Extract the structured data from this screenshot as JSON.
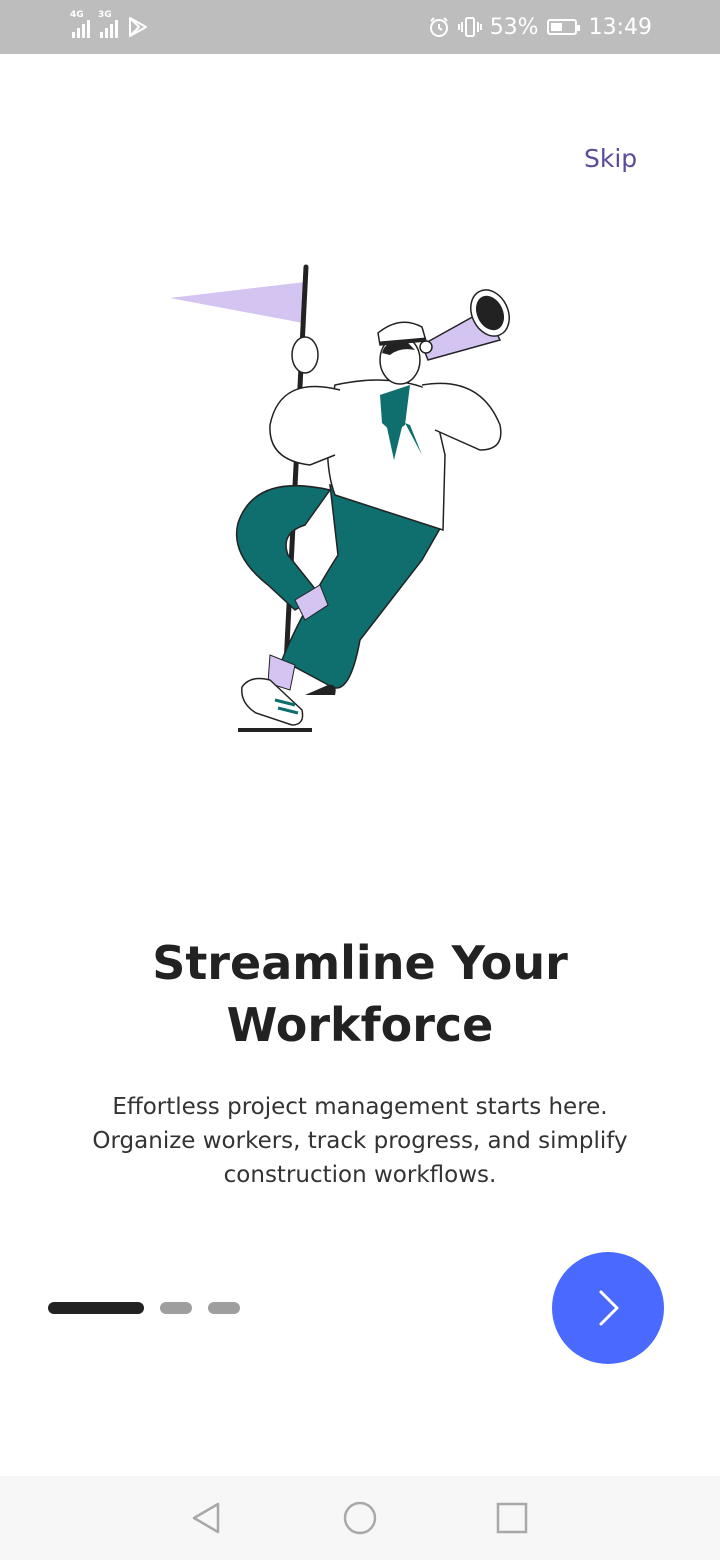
{
  "status_bar": {
    "network_1": "4G",
    "network_2": "3G",
    "battery_percent": "53%",
    "battery_level": 0.53,
    "time": "13:49",
    "icons": [
      "signal-4g-icon",
      "signal-3g-icon",
      "play-store-icon",
      "alarm-icon",
      "vibrate-icon",
      "battery-icon"
    ]
  },
  "header": {
    "skip_label": "Skip"
  },
  "colors": {
    "accent": "#4a69ff",
    "skip_text": "#5a4c9c",
    "teal": "#0f6e6e",
    "lavender": "#d4c4f2",
    "dot_active": "#222222",
    "dot_inactive": "#9e9e9e"
  },
  "onboarding": {
    "title_line1": "Streamline Your",
    "title_line2": "Workforce",
    "desc_line1": "Effortless project management starts here.",
    "desc_line2": "Organize workers, track progress, and simplify",
    "desc_line3": "construction workflows.",
    "page_index": 1,
    "page_count": 3
  },
  "next_button": {
    "icon": "chevron-right-icon"
  },
  "nav_bar": {
    "icons": [
      "back-icon",
      "home-icon",
      "recents-icon"
    ]
  }
}
